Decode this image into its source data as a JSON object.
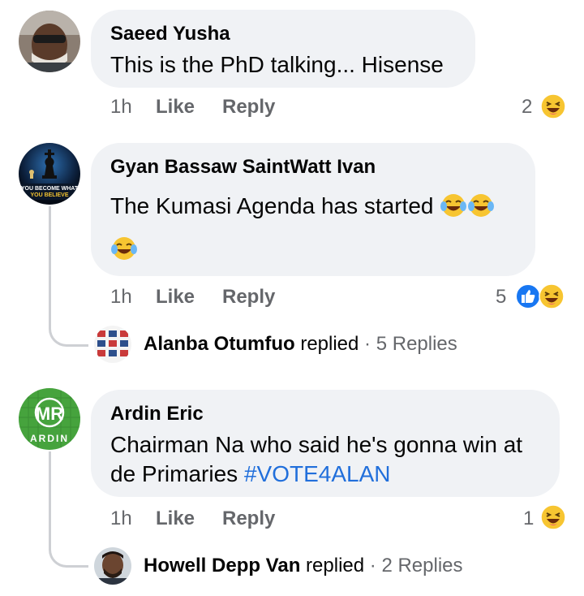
{
  "comments": [
    {
      "author": "Saeed Yusha",
      "text": "This is the PhD talking... Hisense",
      "time": "1h",
      "like_label": "Like",
      "reply_label": "Reply",
      "reaction_count": "2",
      "reactions": [
        "haha-icon"
      ]
    },
    {
      "author": "Gyan Bassaw SaintWatt Ivan",
      "text": "The Kumasi Agenda has started",
      "avatar_caption_line1": "YOU BECOME WHAT",
      "avatar_caption_line2": "YOU BELIEVE",
      "time": "1h",
      "like_label": "Like",
      "reply_label": "Reply",
      "reaction_count": "5",
      "reactions": [
        "like-icon",
        "haha-icon"
      ],
      "replies": {
        "author": "Alanba Otumfuo",
        "replied_label": "replied",
        "separator": "·",
        "count_label": "5 Replies"
      }
    },
    {
      "author": "Ardin Eric",
      "text_line1": "Chairman Na who said he's gonna win at",
      "text_line2": "de Primaries",
      "hashtag": "#VOTE4ALAN",
      "avatar_letters": "MR",
      "avatar_caption": "ARDIN",
      "time": "1h",
      "like_label": "Like",
      "reply_label": "Reply",
      "reaction_count": "1",
      "reactions": [
        "haha-icon"
      ],
      "replies": {
        "author": "Howell Depp Van",
        "replied_label": "replied",
        "separator": "·",
        "count_label": "2 Replies"
      }
    }
  ],
  "colors": {
    "bubble": "#f0f2f5",
    "meta_text": "#65676b",
    "hashtag": "#216fdb",
    "like_blue": "#1877f2",
    "haha_yellow": "#f7c531"
  }
}
